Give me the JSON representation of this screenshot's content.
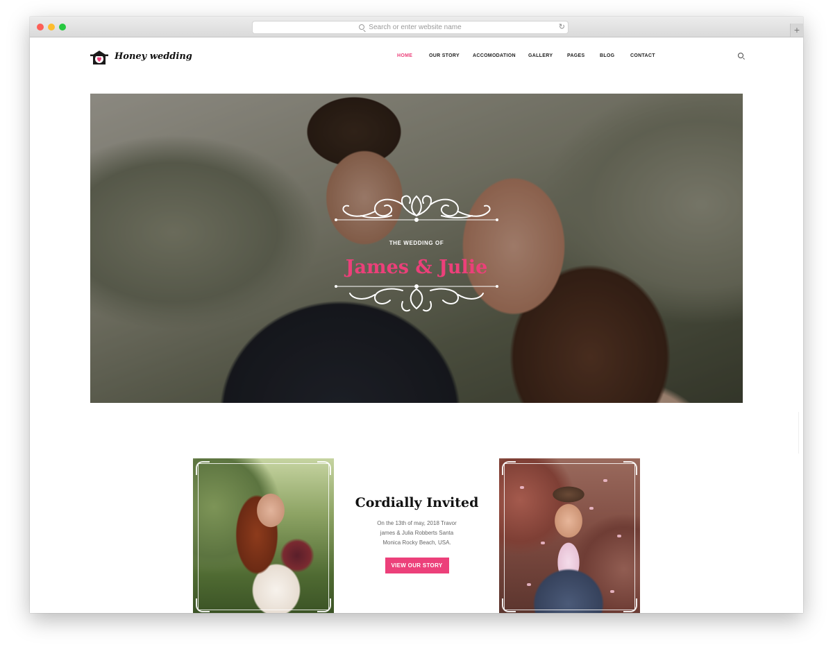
{
  "browser": {
    "url_placeholder": "Search or enter website name"
  },
  "brand": {
    "name": "Honey wedding",
    "accent_color": "#ec407a"
  },
  "nav": {
    "items": [
      {
        "label": "HOME",
        "active": true
      },
      {
        "label": "OUR STORY",
        "active": false
      },
      {
        "label": "ACCOMODATION",
        "active": false
      },
      {
        "label": "GALLERY",
        "active": false
      },
      {
        "label": "PAGES",
        "active": false
      },
      {
        "label": "BLOG",
        "active": false
      },
      {
        "label": "CONTACT",
        "active": false
      }
    ],
    "search_icon": "search-icon"
  },
  "hero": {
    "subtitle": "THE WEDDING OF",
    "title": "James & Julie"
  },
  "invitation": {
    "heading": "Cordially Invited",
    "text": "On the 13th of may, 2018 Travor james & Julia Robberts Santa Monica Rocky Beach, USA.",
    "button_label": "VIEW OUR STORY"
  }
}
